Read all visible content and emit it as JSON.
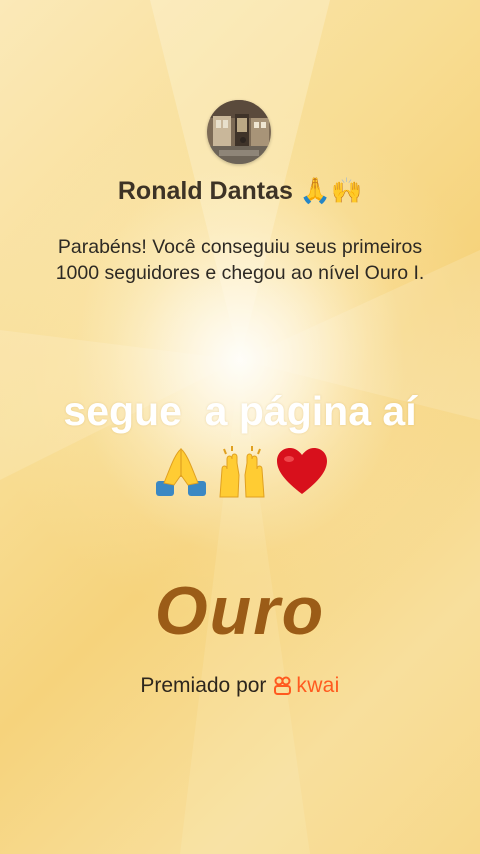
{
  "profile": {
    "name": "Ronald Dantas",
    "name_emojis": "🙏🙌"
  },
  "message": "Parabéns! Você conseguiu seus primeiros 1000 seguidores e chegou ao nível Ouro I.",
  "overlay": {
    "caption": "segue  a página aí",
    "emojis": [
      "praying-hands",
      "raising-hands",
      "red-heart"
    ]
  },
  "level": {
    "title": "Ouro"
  },
  "award": {
    "prefix": "Premiado por",
    "brand": "kwai",
    "brand_color": "#ff5a1f"
  },
  "colors": {
    "gold_text": "#9b5c17",
    "background": "#f8dd93"
  }
}
